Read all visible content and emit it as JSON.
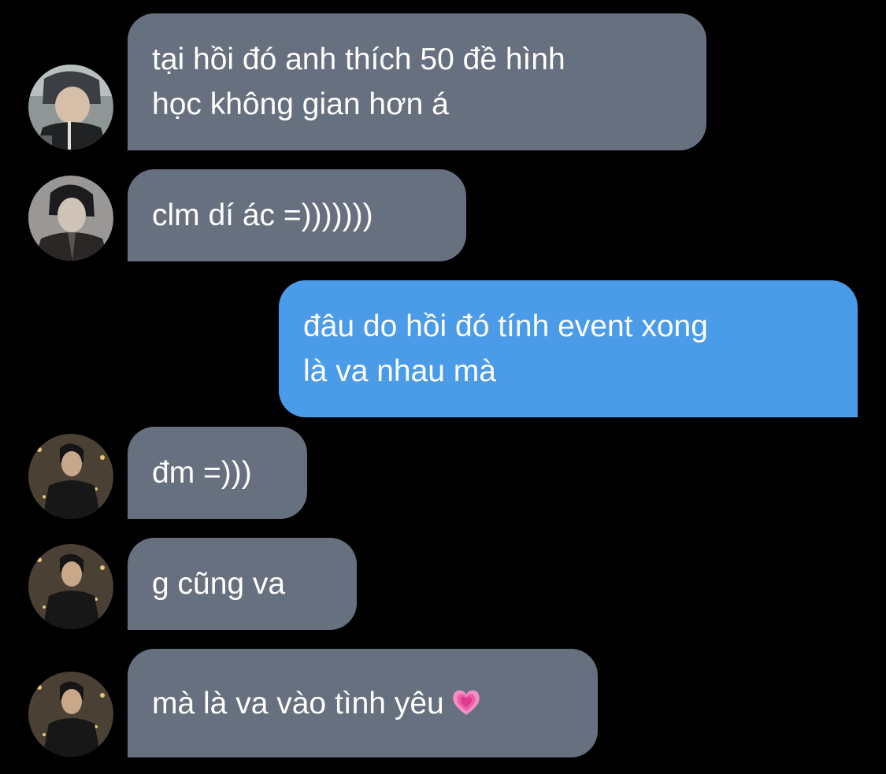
{
  "colors": {
    "background": "#000000",
    "incoming_bubble": "#67707f",
    "outgoing_bubble": "#4a9be8",
    "text": "#ffffff"
  },
  "messages": [
    {
      "direction": "incoming",
      "sender_avatar": "avatar-person-1",
      "lines": [
        "tại hồi đó anh thích 50 đề hình",
        "học không gian hơn á"
      ]
    },
    {
      "direction": "incoming",
      "sender_avatar": "avatar-person-2",
      "lines": [
        "clm dí ác =)))))))"
      ]
    },
    {
      "direction": "outgoing",
      "lines": [
        "đâu do hồi đó tính event xong",
        "là va nhau mà"
      ]
    },
    {
      "direction": "incoming",
      "sender_avatar": "avatar-person-3",
      "lines": [
        "đm =)))"
      ]
    },
    {
      "direction": "incoming",
      "sender_avatar": "avatar-person-3",
      "lines": [
        "g cũng va"
      ]
    },
    {
      "direction": "incoming",
      "sender_avatar": "avatar-person-3",
      "lines": [
        "mà là va vào tình yêu"
      ],
      "emoji": "growing-heart-icon"
    }
  ]
}
